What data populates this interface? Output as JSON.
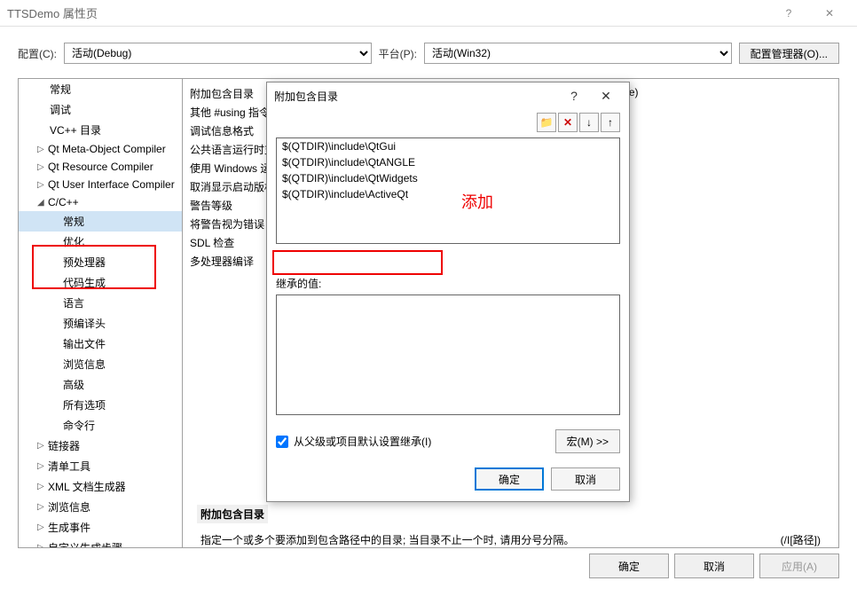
{
  "titlebar": {
    "title": "TTSDemo 属性页",
    "help": "?",
    "close": "✕"
  },
  "config": {
    "label_config": "配置(C):",
    "config_value": "活动(Debug)",
    "label_platform": "平台(P):",
    "platform_value": "活动(Win32)",
    "manager": "配置管理器(O)..."
  },
  "tree": {
    "items": [
      {
        "label": "常规",
        "lvl": 1
      },
      {
        "label": "调试",
        "lvl": 1
      },
      {
        "label": "VC++ 目录",
        "lvl": 1
      },
      {
        "label": "Qt Meta-Object Compiler",
        "lvl": 1,
        "arrow": "▷"
      },
      {
        "label": "Qt Resource Compiler",
        "lvl": 1,
        "arrow": "▷"
      },
      {
        "label": "Qt User Interface Compiler",
        "lvl": 1,
        "arrow": "▷"
      },
      {
        "label": "C/C++",
        "lvl": 1,
        "arrow": "◢"
      },
      {
        "label": "常规",
        "lvl": 2,
        "selected": true
      },
      {
        "label": "优化",
        "lvl": 2
      },
      {
        "label": "预处理器",
        "lvl": 2
      },
      {
        "label": "代码生成",
        "lvl": 2
      },
      {
        "label": "语言",
        "lvl": 2
      },
      {
        "label": "预编译头",
        "lvl": 2
      },
      {
        "label": "输出文件",
        "lvl": 2
      },
      {
        "label": "浏览信息",
        "lvl": 2
      },
      {
        "label": "高级",
        "lvl": 2
      },
      {
        "label": "所有选项",
        "lvl": 2
      },
      {
        "label": "命令行",
        "lvl": 2
      },
      {
        "label": "链接器",
        "lvl": 1,
        "arrow": "▷"
      },
      {
        "label": "清单工具",
        "lvl": 1,
        "arrow": "▷"
      },
      {
        "label": "XML 文档生成器",
        "lvl": 1,
        "arrow": "▷"
      },
      {
        "label": "浏览信息",
        "lvl": 1,
        "arrow": "▷"
      },
      {
        "label": "生成事件",
        "lvl": 1,
        "arrow": "▷"
      },
      {
        "label": "自定义生成步骤",
        "lvl": 1,
        "arrow": "▷"
      },
      {
        "label": "代码分析",
        "lvl": 1,
        "arrow": "▷"
      }
    ]
  },
  "content": {
    "rows": [
      {
        "lbl": "附加包含目录",
        "val": ".\\GeneratedFiles;.;$(QTDIR)\\include;.\\GeneratedFiles\\$(ConfigurationName)"
      },
      {
        "lbl": "其他 #using 指令",
        "val": ""
      },
      {
        "lbl": "调试信息格式",
        "val": ""
      },
      {
        "lbl": "公共语言运行时支持",
        "val": ""
      },
      {
        "lbl": "使用 Windows 运行时扩展",
        "val": ""
      },
      {
        "lbl": "取消显示启动版权标志",
        "val": ""
      },
      {
        "lbl": "警告等级",
        "val": ""
      },
      {
        "lbl": "将警告视为错误",
        "val": ""
      },
      {
        "lbl": "SDL 检查",
        "val": ""
      },
      {
        "lbl": "多处理器编译",
        "val": ""
      }
    ],
    "footer_label": "附加包含目录",
    "footer_desc": "指定一个或多个要添加到包含路径中的目录; 当目录不止一个时, 请用分号分隔。",
    "footer_hint": "(/I[路径])"
  },
  "modal": {
    "title": "附加包含目录",
    "help": "?",
    "close": "✕",
    "list_items": [
      "$(QTDIR)\\include\\QtGui",
      "$(QTDIR)\\include\\QtANGLE",
      "$(QTDIR)\\include\\QtWidgets",
      "$(QTDIR)\\include\\ActiveQt"
    ],
    "inherit_label": "继承的值:",
    "checkbox_label": "从父级或项目默认设置继承(I)",
    "macro_btn": "宏(M) >>",
    "ok": "确定",
    "cancel": "取消"
  },
  "footer_btns": {
    "ok": "确定",
    "cancel": "取消",
    "apply": "应用(A)"
  },
  "annotation": "添加"
}
